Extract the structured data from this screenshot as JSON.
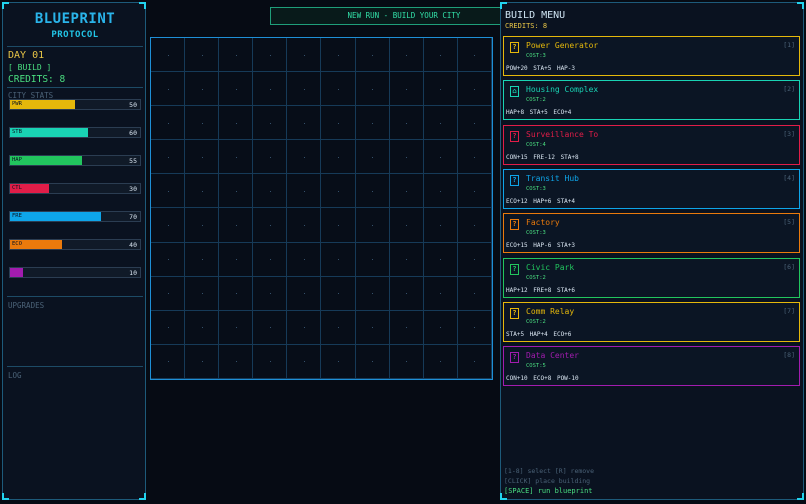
{
  "app": {
    "title_line1": "BLUEPRINT",
    "title_line2": "PROTOCOL"
  },
  "status": {
    "day": "DAY 01",
    "phase": "[ BUILD ]",
    "credits": "CREDITS: 8"
  },
  "sections": {
    "city_stats": "CITY STATS",
    "upgrades": "UPGRADES",
    "log": "LOG"
  },
  "stats": [
    {
      "label": "PWR",
      "value": 50,
      "color": "#e5b80b"
    },
    {
      "label": "STB",
      "value": 60,
      "color": "#19d3b4"
    },
    {
      "label": "HAP",
      "value": 55,
      "color": "#22c55e"
    },
    {
      "label": "CTL",
      "value": 30,
      "color": "#e11d48"
    },
    {
      "label": "FRE",
      "value": 70,
      "color": "#0ea5e9"
    },
    {
      "label": "ECO",
      "value": 40,
      "color": "#ea7a0c"
    },
    {
      "label": "",
      "value": 10,
      "color": "#a21caf"
    }
  ],
  "banner": "NEW RUN - BUILD YOUR CITY",
  "build_menu": {
    "title": "BUILD MENU",
    "credits": "CREDITS: 8",
    "items": [
      {
        "name": "Power Generator",
        "cost": "COST:3",
        "effects": "POW+20 STA+5 HAP-3",
        "key": "[1]",
        "icon": "building-icon",
        "glyph": "?",
        "color": "#e5b80b"
      },
      {
        "name": "Housing Complex",
        "cost": "COST:2",
        "effects": "HAP+8 STA+5 ECO+4",
        "key": "[2]",
        "icon": "house-icon",
        "glyph": "⌂",
        "color": "#19d3b4"
      },
      {
        "name": "Surveillance To",
        "cost": "COST:4",
        "effects": "CON+15 FRE-12 STA+8",
        "key": "[3]",
        "icon": "building-icon",
        "glyph": "?",
        "color": "#e11d48"
      },
      {
        "name": "Transit Hub",
        "cost": "COST:3",
        "effects": "ECO+12 HAP+6 STA+4",
        "key": "[4]",
        "icon": "building-icon",
        "glyph": "?",
        "color": "#0ea5e9"
      },
      {
        "name": "Factory",
        "cost": "COST:3",
        "effects": "ECO+15 HAP-6 STA+3",
        "key": "[5]",
        "icon": "building-icon",
        "glyph": "?",
        "color": "#ea7a0c"
      },
      {
        "name": "Civic Park",
        "cost": "COST:2",
        "effects": "HAP+12 FRE+8 STA+6",
        "key": "[6]",
        "icon": "building-icon",
        "glyph": "?",
        "color": "#22c55e"
      },
      {
        "name": "Comm Relay",
        "cost": "COST:2",
        "effects": "STA+5 HAP+4 ECO+6",
        "key": "[7]",
        "icon": "building-icon",
        "glyph": "?",
        "color": "#e5b80b"
      },
      {
        "name": "Data Center",
        "cost": "COST:5",
        "effects": "CON+10 ECO+8 POW-10",
        "key": "[8]",
        "icon": "building-icon",
        "glyph": "?",
        "color": "#a21caf"
      }
    ]
  },
  "help": {
    "select": "[1-8] select [R] remove",
    "place": "[CLICK] place building",
    "run": "[SPACE] run blueprint"
  }
}
